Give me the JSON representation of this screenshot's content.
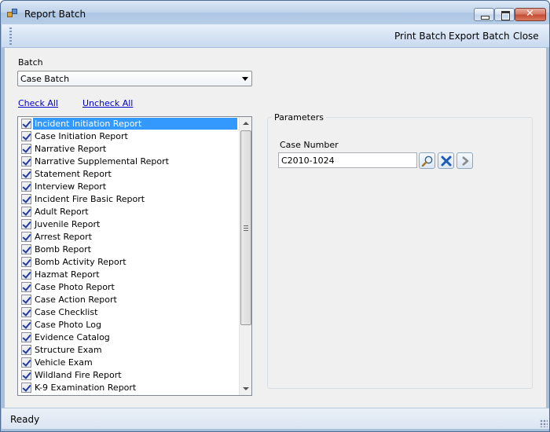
{
  "window": {
    "title": "Report Batch"
  },
  "toolbar": {
    "print_label": "Print Batch",
    "export_label": "Export Batch",
    "close_label": "Close"
  },
  "batch": {
    "label": "Batch",
    "selected": "Case Batch"
  },
  "links": {
    "check_all": "Check All",
    "uncheck_all": "Uncheck All"
  },
  "reports": {
    "items": [
      {
        "label": "Incident Initiation Report",
        "checked": true,
        "selected": true
      },
      {
        "label": "Case Initiation Report",
        "checked": true
      },
      {
        "label": "Narrative Report",
        "checked": true
      },
      {
        "label": "Narrative Supplemental Report",
        "checked": true
      },
      {
        "label": "Statement Report",
        "checked": true
      },
      {
        "label": "Interview Report",
        "checked": true
      },
      {
        "label": "Incident Fire Basic Report",
        "checked": true
      },
      {
        "label": "Adult Report",
        "checked": true
      },
      {
        "label": "Juvenile Report",
        "checked": true
      },
      {
        "label": "Arrest Report",
        "checked": true
      },
      {
        "label": "Bomb Report",
        "checked": true
      },
      {
        "label": "Bomb Activity Report",
        "checked": true
      },
      {
        "label": "Hazmat Report",
        "checked": true
      },
      {
        "label": "Case Photo Report",
        "checked": true
      },
      {
        "label": "Case Action Report",
        "checked": true
      },
      {
        "label": "Case Checklist",
        "checked": true
      },
      {
        "label": "Case Photo Log",
        "checked": true
      },
      {
        "label": "Evidence Catalog",
        "checked": true
      },
      {
        "label": "Structure Exam",
        "checked": true
      },
      {
        "label": "Vehicle Exam",
        "checked": true
      },
      {
        "label": "Wildland Fire Report",
        "checked": true
      },
      {
        "label": "K-9 Examination Report",
        "checked": true
      }
    ]
  },
  "parameters": {
    "title": "Parameters",
    "case_number_label": "Case Number",
    "case_number_value": "C2010-1024"
  },
  "status": {
    "text": "Ready"
  },
  "icons": {
    "search": "magnifier-icon",
    "clear": "x-icon",
    "go": "chevron-right-icon"
  },
  "colors": {
    "selection": "#3399ff",
    "link": "#0000cc",
    "check": "#21399e"
  }
}
